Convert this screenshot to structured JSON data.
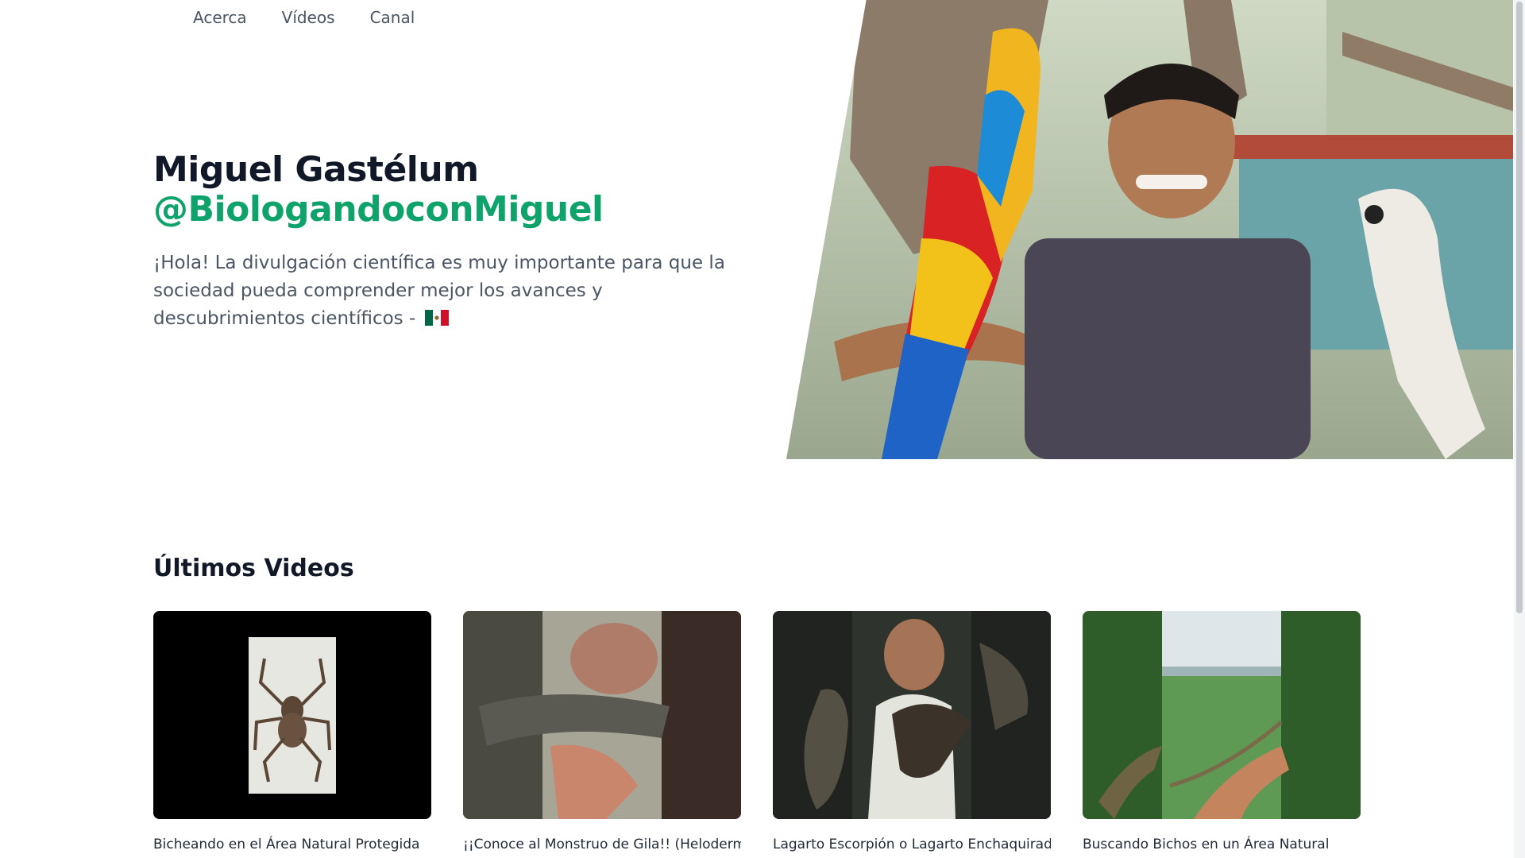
{
  "nav": {
    "items": [
      "Acerca",
      "Vídeos",
      "Canal"
    ]
  },
  "hero": {
    "name": "Miguel Gastélum",
    "handle": "@BiologandoconMiguel",
    "description": "¡Hola! La divulgación científica es muy importante para que la sociedad pueda comprender mejor los avances y descubrimientos científicos -",
    "flag": "mexico-flag-icon"
  },
  "videos_section": {
    "title": "Últimos Videos",
    "videos": [
      {
        "title": "Bicheando en el Área Natural Protegida",
        "thumbnail": "tarantula-thumbnail"
      },
      {
        "title": "¡¡Conoce al Monstruo de Gila!! (Heloderma",
        "thumbnail": "gila-monster-thumbnail"
      },
      {
        "title": "Lagarto Escorpión o Lagarto Enchaquirado",
        "thumbnail": "beaded-lizard-thumbnail"
      },
      {
        "title": "Buscando Bichos en un Área Natural",
        "thumbnail": "mantis-thumbnail"
      }
    ]
  },
  "colors": {
    "accent": "#0fa36b",
    "text": "#111827",
    "muted": "#4b5563"
  }
}
